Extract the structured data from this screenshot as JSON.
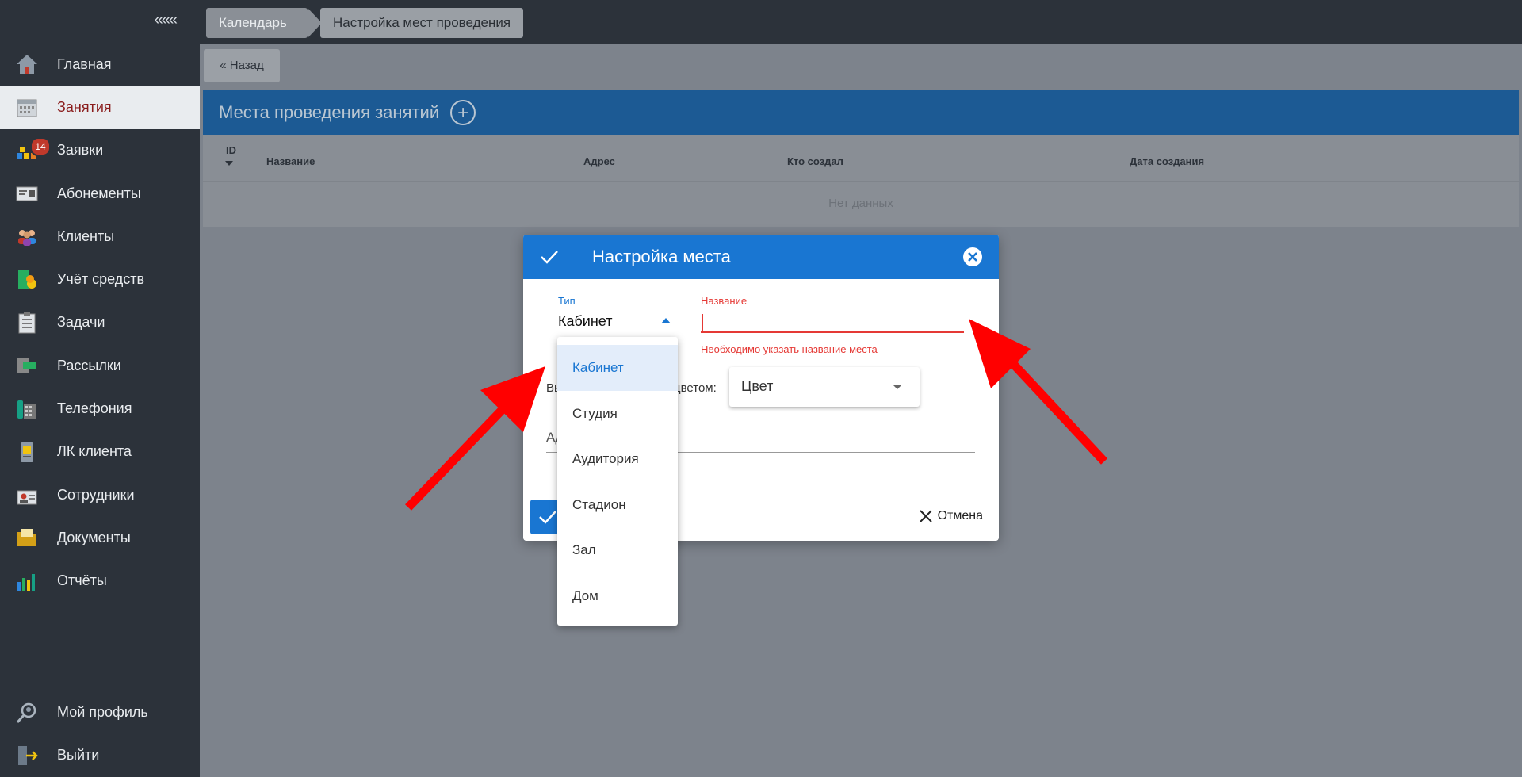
{
  "sidebar": {
    "collapse_label": "«««",
    "items": [
      {
        "label": "Главная",
        "icon": "home-icon"
      },
      {
        "label": "Занятия",
        "icon": "calendar-icon",
        "active": true
      },
      {
        "label": "Заявки",
        "icon": "requests-icon",
        "badge": "14"
      },
      {
        "label": "Абонементы",
        "icon": "subscription-card-icon"
      },
      {
        "label": "Клиенты",
        "icon": "clients-icon"
      },
      {
        "label": "Учёт средств",
        "icon": "money-icon"
      },
      {
        "label": "Задачи",
        "icon": "tasks-icon"
      },
      {
        "label": "Рассылки",
        "icon": "mailing-icon"
      },
      {
        "label": "Телефония",
        "icon": "phone-icon"
      },
      {
        "label": "ЛК клиента",
        "icon": "client-account-icon"
      },
      {
        "label": "Сотрудники",
        "icon": "employees-icon"
      },
      {
        "label": "Документы",
        "icon": "documents-icon"
      },
      {
        "label": "Отчёты",
        "icon": "reports-icon"
      }
    ],
    "bottom_items": [
      {
        "label": "Мой профиль",
        "icon": "profile-icon"
      },
      {
        "label": "Выйти",
        "icon": "logout-icon"
      }
    ]
  },
  "breadcrumb": {
    "items": [
      "Календарь",
      "Настройка мест проведения"
    ]
  },
  "main": {
    "back_label": "« Назад",
    "panel_title": "Места проведения занятий",
    "add_label": "+",
    "table": {
      "columns": [
        "ID",
        "Название",
        "Адрес",
        "Кто создал",
        "Дата создания"
      ],
      "empty_text": "Нет данных"
    }
  },
  "modal": {
    "title": "Настройка места",
    "type_label": "Тип",
    "type_value": "Кабинет",
    "name_label": "Название",
    "name_value": "",
    "name_error": "Необходимо указать название места",
    "color_label_start": "Вы",
    "color_label_end": "цветом:",
    "color_placeholder": "Цвет",
    "address_label": "Ад",
    "cancel_label": "Отмена"
  },
  "dropdown": {
    "options": [
      "Кабинет",
      "Студия",
      "Аудитория",
      "Стадион",
      "Зал",
      "Дом"
    ],
    "selected": "Кабинет"
  },
  "colors": {
    "accent": "#1976d2",
    "error": "#e53935",
    "sidebar_bg": "#2c323a",
    "annotation_arrow": "#ff0000"
  }
}
